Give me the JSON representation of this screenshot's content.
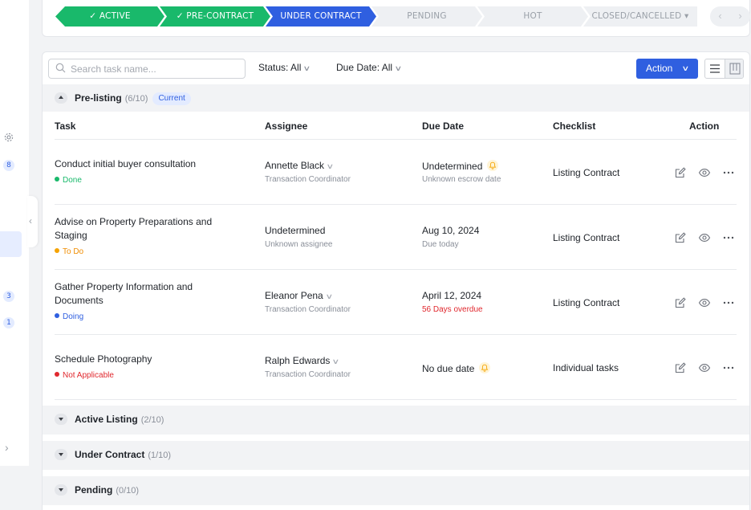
{
  "stages": [
    {
      "label": "ACTIVE",
      "state": "done"
    },
    {
      "label": "PRE-CONTRACT",
      "state": "done"
    },
    {
      "label": "UNDER CONTRACT",
      "state": "current"
    },
    {
      "label": "PENDING",
      "state": "todo"
    },
    {
      "label": "HOT",
      "state": "todo"
    },
    {
      "label": "CLOSED/CANCELLED",
      "state": "todo"
    }
  ],
  "stage_check_glyph": "✓",
  "closed_caret": "▾",
  "pager": {
    "prev": "‹",
    "next": "›"
  },
  "sidebar": {
    "badges": [
      "8",
      "3",
      "1"
    ],
    "gear_icon": "gear-icon",
    "expand_glyph": "›",
    "collapse_glyph": "‹"
  },
  "toolbar": {
    "search_placeholder": "Search task name...",
    "status_filter": "Status: All",
    "due_filter": "Due Date: All",
    "action_label": "Action",
    "chevron": "∨"
  },
  "group": {
    "name": "Pre-listing",
    "count": "(6/10)",
    "badge": "Current"
  },
  "columns": {
    "task": "Task",
    "assignee": "Assignee",
    "due": "Due Date",
    "checklist": "Checklist",
    "action": "Action"
  },
  "rows": [
    {
      "task": "Conduct initial buyer consultation",
      "status": "Done",
      "assignee": "Annette Black",
      "role": "Transaction Coordinator",
      "due": "Undetermined",
      "due_sub": "Unknown escrow date",
      "checklist": "Listing Contract"
    },
    {
      "task": "Advise on Property Preparations and Staging",
      "status": "To Do",
      "assignee": "Undetermined",
      "role": "Unknown assignee",
      "due": "Aug 10, 2024",
      "due_sub": "Due today",
      "checklist": "Listing Contract"
    },
    {
      "task": "Gather Property Information and Documents",
      "status": "Doing",
      "assignee": "Eleanor Pena",
      "role": "Transaction Coordinator",
      "due": "April 12, 2024",
      "due_sub": "56 Days overdue",
      "checklist": "Listing Contract"
    },
    {
      "task": "Schedule Photography",
      "status": "Not Applicable",
      "assignee": "Ralph Edwards",
      "role": "Transaction Coordinator",
      "due": "No due date",
      "due_sub": "",
      "checklist": "Individual tasks"
    }
  ],
  "collapsed_groups": [
    {
      "name": "Active Listing",
      "count": "(2/10)"
    },
    {
      "name": "Under Contract",
      "count": "(1/10)"
    },
    {
      "name": "Pending",
      "count": "(0/10)"
    }
  ],
  "colors": {
    "done": "#19b96b",
    "current": "#2f5fe0",
    "todo": "#f5a300",
    "na": "#e0282e"
  }
}
